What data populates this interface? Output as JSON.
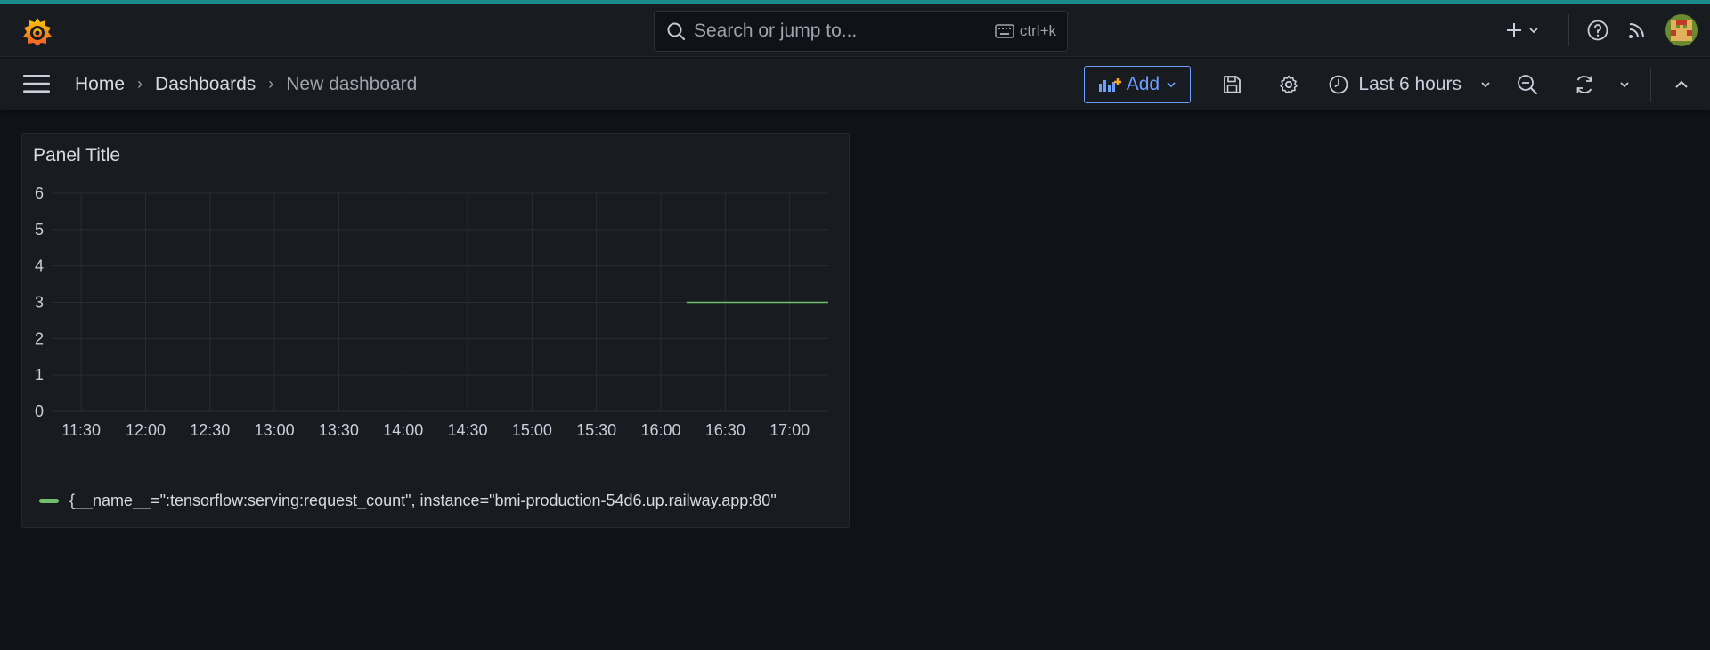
{
  "search": {
    "placeholder": "Search or jump to...",
    "shortcut": "ctrl+k"
  },
  "breadcrumb": {
    "home": "Home",
    "dashboards": "Dashboards",
    "current": "New dashboard"
  },
  "toolbar": {
    "add_label": "Add",
    "time_range": "Last 6 hours"
  },
  "panel": {
    "title": "Panel Title",
    "legend": "{__name__=\":tensorflow:serving:request_count\", instance=\"bmi-production-54d6.up.railway.app:80\""
  },
  "colors": {
    "accent": "#6e9fff",
    "series": "#73bf69",
    "brand": "#f46800"
  },
  "chart_data": {
    "type": "line",
    "title": "Panel Title",
    "x_ticks": [
      "11:30",
      "12:00",
      "12:30",
      "13:00",
      "13:30",
      "14:00",
      "14:30",
      "15:00",
      "15:30",
      "16:00",
      "16:30",
      "17:00"
    ],
    "y_ticks": [
      0,
      1,
      2,
      3,
      4,
      5,
      6
    ],
    "ylim": [
      0,
      6
    ],
    "xlim": [
      "11:15",
      "17:18"
    ],
    "grid": true,
    "legend_position": "bottom-left",
    "series": [
      {
        "name": "{__name__=\":tensorflow:serving:request_count\", instance=\"bmi-production-54d6.up.railway.app:80\"",
        "color": "#73bf69",
        "x": [
          "16:12",
          "17:18"
        ],
        "y": [
          3,
          3
        ]
      }
    ]
  }
}
